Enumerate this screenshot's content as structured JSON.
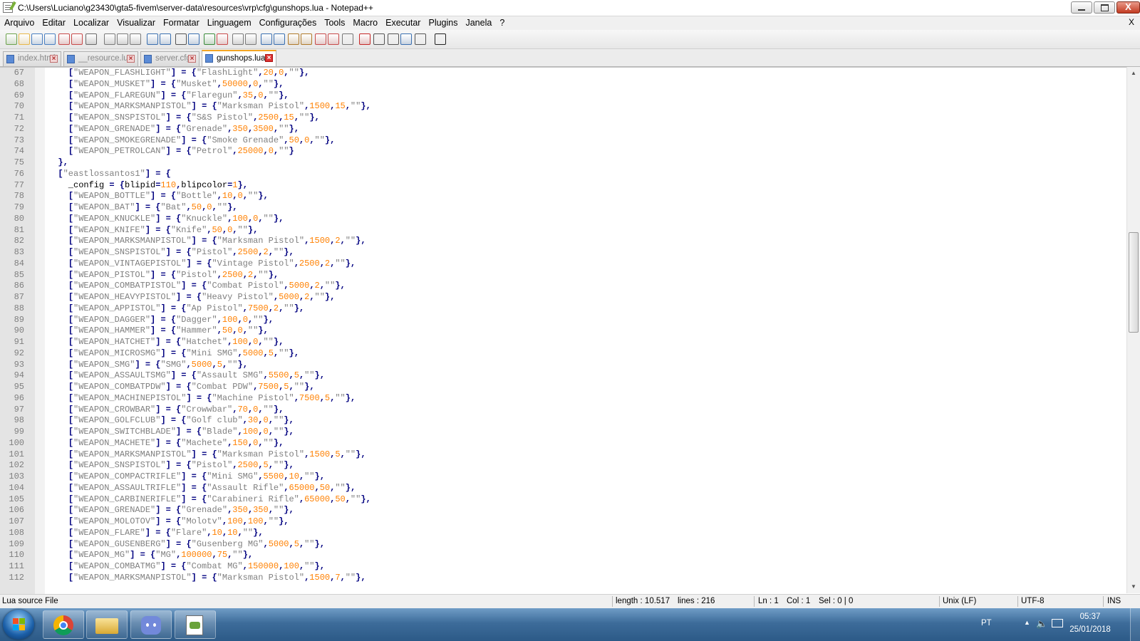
{
  "window": {
    "title": "C:\\Users\\Luciano\\g23430\\gta5-fivem\\server-data\\resources\\vrp\\cfg\\gunshops.lua - Notepad++",
    "close_glyph": "X"
  },
  "menu": {
    "items": [
      "Arquivo",
      "Editar",
      "Localizar",
      "Visualizar",
      "Formatar",
      "Linguagem",
      "Configurações",
      "Tools",
      "Macro",
      "Executar",
      "Plugins",
      "Janela",
      "?"
    ],
    "close_doc": "X"
  },
  "toolbar": {
    "buttons": [
      "new-file",
      "open-file",
      "save",
      "save-all",
      "close",
      "close-all",
      "print",
      "cut",
      "copy",
      "paste",
      "undo",
      "redo",
      "find",
      "replace",
      "zoom-in",
      "zoom-out",
      "sync-vertical",
      "sync-horizontal",
      "word-wrap",
      "show-all-chars",
      "indent-guide",
      "doc-map",
      "function-list",
      "folder-workspace",
      "monitoring",
      "record-macro",
      "stop-macro",
      "play-macro",
      "run-macro-multiple",
      "save-macro",
      "spell-check"
    ]
  },
  "tabs": [
    {
      "label": "index.html",
      "active": false
    },
    {
      "label": "__resource.lua",
      "active": false
    },
    {
      "label": "server.cfg",
      "active": false
    },
    {
      "label": "gunshops.lua",
      "active": true
    }
  ],
  "editor": {
    "lines": [
      {
        "n": "67",
        "text": "    [\"WEAPON_FLASHLIGHT\"] = {\"FlashLight\",20,0,\"\"},"
      },
      {
        "n": "68",
        "text": "    [\"WEAPON_MUSKET\"] = {\"Musket\",50000,0,\"\"},"
      },
      {
        "n": "69",
        "text": "    [\"WEAPON_FLAREGUN\"] = {\"Flaregun\",35,0,\"\"},"
      },
      {
        "n": "70",
        "text": "    [\"WEAPON_MARKSMANPISTOL\"] = {\"Marksman Pistol\",1500,15,\"\"},"
      },
      {
        "n": "71",
        "text": "    [\"WEAPON_SNSPISTOL\"] = {\"S&S Pistol\",2500,15,\"\"},"
      },
      {
        "n": "72",
        "text": "    [\"WEAPON_GRENADE\"] = {\"Grenade\",350,3500,\"\"},"
      },
      {
        "n": "73",
        "text": "    [\"WEAPON_SMOKEGRENADE\"] = {\"Smoke Grenade\",50,0,\"\"},"
      },
      {
        "n": "74",
        "text": "    [\"WEAPON_PETROLCAN\"] = {\"Petrol\",25000,0,\"\"}"
      },
      {
        "n": "75",
        "text": "  },"
      },
      {
        "n": "76",
        "text": "  [\"eastlossantos1\"] = {"
      },
      {
        "n": "77",
        "text": "    _config = {blipid=110,blipcolor=1},"
      },
      {
        "n": "78",
        "text": "    [\"WEAPON_BOTTLE\"] = {\"Bottle\",10,0,\"\"},"
      },
      {
        "n": "79",
        "text": "    [\"WEAPON_BAT\"] = {\"Bat\",50,0,\"\"},"
      },
      {
        "n": "80",
        "text": "    [\"WEAPON_KNUCKLE\"] = {\"Knuckle\",100,0,\"\"},"
      },
      {
        "n": "81",
        "text": "    [\"WEAPON_KNIFE\"] = {\"Knife\",50,0,\"\"},"
      },
      {
        "n": "82",
        "text": "    [\"WEAPON_MARKSMANPISTOL\"] = {\"Marksman Pistol\",1500,2,\"\"},"
      },
      {
        "n": "83",
        "text": "    [\"WEAPON_SNSPISTOL\"] = {\"Pistol\",2500,2,\"\"},"
      },
      {
        "n": "84",
        "text": "    [\"WEAPON_VINTAGEPISTOL\"] = {\"Vintage Pistol\",2500,2,\"\"},"
      },
      {
        "n": "85",
        "text": "    [\"WEAPON_PISTOL\"] = {\"Pistol\",2500,2,\"\"},"
      },
      {
        "n": "86",
        "text": "    [\"WEAPON_COMBATPISTOL\"] = {\"Combat Pistol\",5000,2,\"\"},"
      },
      {
        "n": "87",
        "text": "    [\"WEAPON_HEAVYPISTOL\"] = {\"Heavy Pistol\",5000,2,\"\"},"
      },
      {
        "n": "88",
        "text": "    [\"WEAPON_APPISTOL\"] = {\"Ap Pistol\",7500,2,\"\"},"
      },
      {
        "n": "89",
        "text": "    [\"WEAPON_DAGGER\"] = {\"Dagger\",100,0,\"\"},"
      },
      {
        "n": "90",
        "text": "    [\"WEAPON_HAMMER\"] = {\"Hammer\",50,0,\"\"},"
      },
      {
        "n": "91",
        "text": "    [\"WEAPON_HATCHET\"] = {\"Hatchet\",100,0,\"\"},"
      },
      {
        "n": "92",
        "text": "    [\"WEAPON_MICROSMG\"] = {\"Mini SMG\",5000,5,\"\"},"
      },
      {
        "n": "93",
        "text": "    [\"WEAPON_SMG\"] = {\"SMG\",5000,5,\"\"},"
      },
      {
        "n": "94",
        "text": "    [\"WEAPON_ASSAULTSMG\"] = {\"Assault SMG\",5500,5,\"\"},"
      },
      {
        "n": "95",
        "text": "    [\"WEAPON_COMBATPDW\"] = {\"Combat PDW\",7500,5,\"\"},"
      },
      {
        "n": "96",
        "text": "    [\"WEAPON_MACHINEPISTOL\"] = {\"Machine Pistol\",7500,5,\"\"},"
      },
      {
        "n": "97",
        "text": "    [\"WEAPON_CROWBAR\"] = {\"Crowwbar\",70,0,\"\"},"
      },
      {
        "n": "98",
        "text": "    [\"WEAPON_GOLFCLUB\"] = {\"Golf club\",30,0,\"\"},"
      },
      {
        "n": "99",
        "text": "    [\"WEAPON_SWITCHBLADE\"] = {\"Blade\",100,0,\"\"},"
      },
      {
        "n": "100",
        "text": "    [\"WEAPON_MACHETE\"] = {\"Machete\",150,0,\"\"},"
      },
      {
        "n": "101",
        "text": "    [\"WEAPON_MARKSMANPISTOL\"] = {\"Marksman Pistol\",1500,5,\"\"},"
      },
      {
        "n": "102",
        "text": "    [\"WEAPON_SNSPISTOL\"] = {\"Pistol\",2500,5,\"\"},"
      },
      {
        "n": "103",
        "text": "    [\"WEAPON_COMPACTRIFLE\"] = {\"Mini SMG\",5500,10,\"\"},"
      },
      {
        "n": "104",
        "text": "    [\"WEAPON_ASSAULTRIFLE\"] = {\"Assault Rifle\",65000,50,\"\"},"
      },
      {
        "n": "105",
        "text": "    [\"WEAPON_CARBINERIFLE\"] = {\"Carabineri Rifle\",65000,50,\"\"},"
      },
      {
        "n": "106",
        "text": "    [\"WEAPON_GRENADE\"] = {\"Grenade\",350,350,\"\"},"
      },
      {
        "n": "107",
        "text": "    [\"WEAPON_MOLOTOV\"] = {\"Molotv\",100,100,\"\"},"
      },
      {
        "n": "108",
        "text": "    [\"WEAPON_FLARE\"] = {\"Flare\",10,10,\"\"},"
      },
      {
        "n": "109",
        "text": "    [\"WEAPON_GUSENBERG\"] = {\"Gusenberg MG\",5000,5,\"\"},"
      },
      {
        "n": "110",
        "text": "    [\"WEAPON_MG\"] = {\"MG\",100000,75,\"\"},"
      },
      {
        "n": "111",
        "text": "    [\"WEAPON_COMBATMG\"] = {\"Combat MG\",150000,100,\"\"},"
      },
      {
        "n": "112",
        "text": "    [\"WEAPON_MARKSMANPISTOL\"] = {\"Marksman Pistol\",1500,7,\"\"},"
      }
    ],
    "scroll_position": 0.38,
    "scroll_visible": 0.2
  },
  "statusbar": {
    "file_type": "Lua source File",
    "length": "length : 10.517",
    "lines": "lines : 216",
    "ln": "Ln : 1",
    "col": "Col : 1",
    "sel": "Sel : 0 | 0",
    "eol": "Unix (LF)",
    "encoding": "UTF-8",
    "mode": "INS"
  },
  "taskbar": {
    "apps": [
      "chrome-icon",
      "file-explorer-icon",
      "discord-icon",
      "notepad-plus-plus-icon"
    ],
    "language": "PT",
    "time": "05:37",
    "date": "25/01/2018"
  },
  "colors": {
    "string": "#808080",
    "number": "#ff8000",
    "operator": "#000080",
    "active_tab_accent": "#f5a623"
  }
}
